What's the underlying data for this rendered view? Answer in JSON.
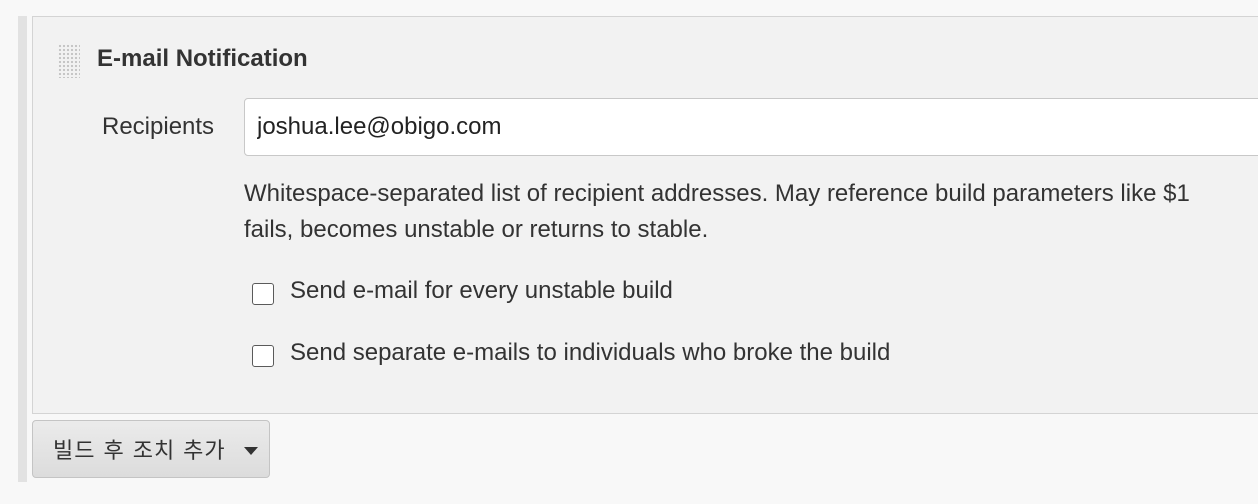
{
  "section": {
    "title": "E-mail Notification"
  },
  "recipients": {
    "label": "Recipients",
    "value": "joshua.lee@obigo.com"
  },
  "help": {
    "line1": "Whitespace-separated list of recipient addresses. May reference build parameters like $1",
    "line2": "fails, becomes unstable or returns to stable."
  },
  "options": {
    "unstable": {
      "label": "Send e-mail for every unstable build",
      "checked": false
    },
    "individuals": {
      "label": "Send separate e-mails to individuals who broke the build",
      "checked": false
    }
  },
  "add_action": {
    "label": "빌드 후 조치 추가"
  },
  "icons": {
    "drag_handle": "drag-handle-icon",
    "caret": "caret-down-icon"
  }
}
